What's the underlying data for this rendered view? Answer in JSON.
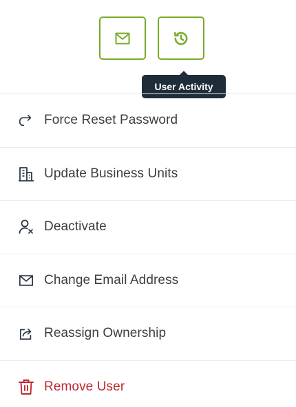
{
  "top_actions": {
    "email_icon": "envelope-icon",
    "activity_icon": "history-icon",
    "tooltip": "User Activity"
  },
  "menu": {
    "items": [
      {
        "label": "Force Reset Password",
        "icon": "redo-arrow-icon"
      },
      {
        "label": "Update Business Units",
        "icon": "building-icon"
      },
      {
        "label": "Deactivate",
        "icon": "user-x-icon"
      },
      {
        "label": "Change Email Address",
        "icon": "envelope-icon"
      },
      {
        "label": "Reassign Ownership",
        "icon": "share-icon"
      },
      {
        "label": "Remove User",
        "icon": "trash-icon"
      }
    ]
  },
  "colors": {
    "accent": "#7aab2a",
    "tooltip_bg": "#1f2d3a",
    "text": "#3a3d42",
    "danger": "#c0272d"
  }
}
